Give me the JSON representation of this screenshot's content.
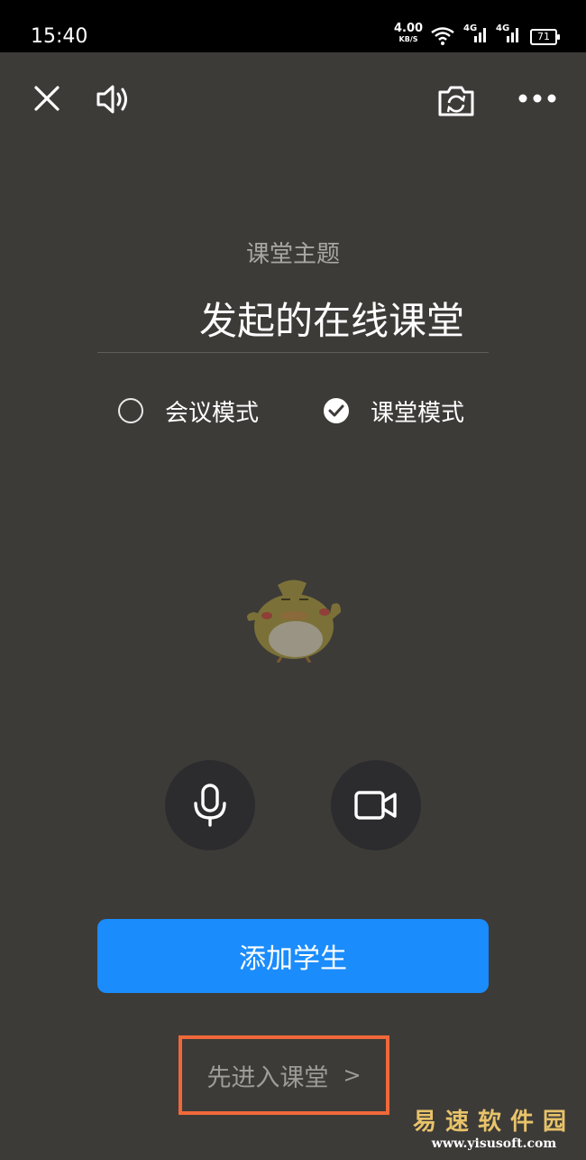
{
  "status_bar": {
    "time": "15:40",
    "net_speed": "4.00",
    "net_speed_unit": "KB/S",
    "signal_1": "4G",
    "signal_2": "4G",
    "battery": "71"
  },
  "toolbar": {
    "close_icon": "close-icon",
    "speaker_icon": "speaker-icon",
    "flip_icon": "camera-flip-icon",
    "more_icon": "more-icon"
  },
  "topic": {
    "label": "课堂主题",
    "title": "发起的在线课堂"
  },
  "modes": [
    {
      "label": "会议模式",
      "selected": false
    },
    {
      "label": "课堂模式",
      "selected": true
    }
  ],
  "controls": {
    "mic_icon": "microphone-icon",
    "camera_icon": "video-camera-icon"
  },
  "primary_button": {
    "label": "添加学生",
    "color": "#1b8cfc"
  },
  "enter_link": {
    "label": "先进入课堂",
    "chevron": ">",
    "highlight_color": "#f0683a"
  },
  "watermark": {
    "cn": "易速软件园",
    "url": "www.yisusoft.com"
  }
}
